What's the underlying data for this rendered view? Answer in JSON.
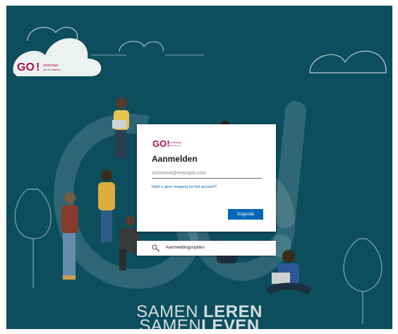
{
  "brand": {
    "logo_text": "GO!",
    "logo_subtext": "onderwijs van de Vlaamse Gemeenschap",
    "accent_color": "#b0124a"
  },
  "background": {
    "color": "#0d4e5e",
    "slogan_line1_light": "SAMEN ",
    "slogan_line1_bold": "LEREN",
    "slogan_line2_light": "SAMEN",
    "slogan_line2_bold": "LEVEN"
  },
  "signin": {
    "title": "Aanmelden",
    "email_placeholder": "someone@example.com",
    "email_value": "",
    "no_account_link": "Hebt u geen toegang tot het account?",
    "next_button": "Volgende",
    "button_color": "#0067b8"
  },
  "options": {
    "label": "Aanmeldingsopties",
    "icon": "key-icon"
  }
}
